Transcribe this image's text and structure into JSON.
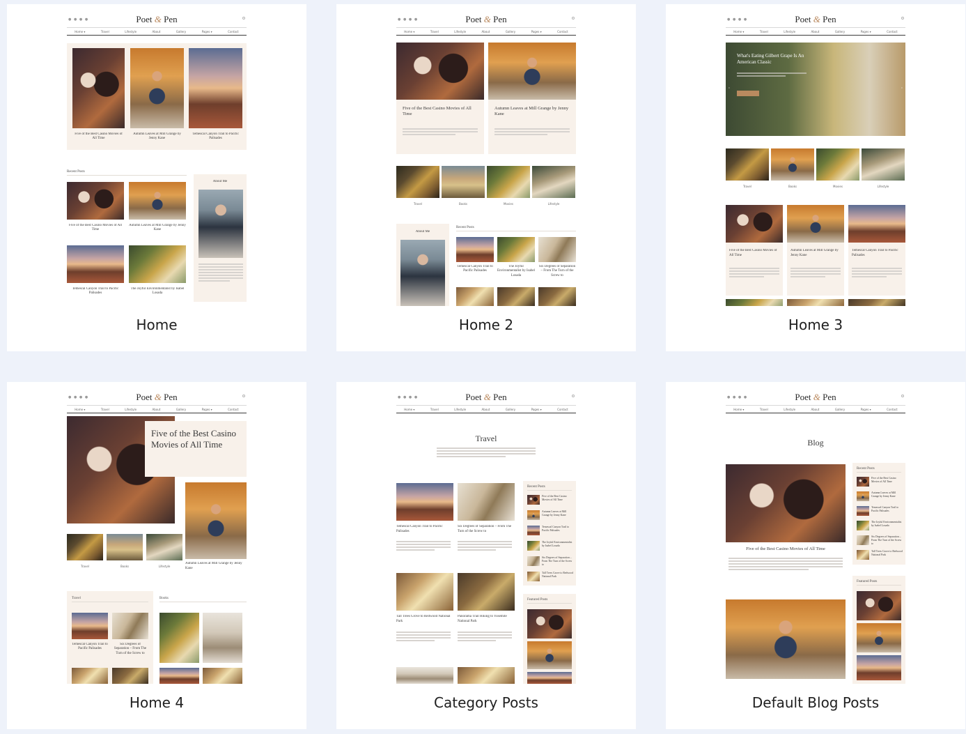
{
  "logo": {
    "left": "Poet",
    "amp": "&",
    "right": "Pen"
  },
  "nav_items": [
    "Home ▾",
    "Travel",
    "Lifestyle",
    "About",
    "Gallery",
    "Pages ▾",
    "Contact"
  ],
  "cards": [
    {
      "label": "Home"
    },
    {
      "label": "Home 2"
    },
    {
      "label": "Home 3"
    },
    {
      "label": "Home 4"
    },
    {
      "label": "Category Posts"
    },
    {
      "label": "Default Blog Posts"
    }
  ],
  "home": {
    "captions": [
      "Five of the Best Casino Movies of All Time",
      "Autumn Leaves at Mill Grange by Jenny Kane",
      "Temescal Canyon Trail to Pacific Palisades"
    ],
    "recent_posts": "Recent Posts",
    "about_me": "About Me",
    "grid_captions": [
      "Five of the Best Casino Movies of All Time",
      "Autumn Leaves at Mill Grange by Jenny Kane",
      "Temescal Canyon Trail to Pacific Palisades",
      "The Joyful Environmentalist by Isabel Losada"
    ]
  },
  "home2": {
    "posts": [
      "Five of the Best Casino Movies of All Time",
      "Autumn Leaves at Mill Grange by Jenny Kane"
    ],
    "categories": [
      "Travel",
      "Books",
      "Movies",
      "Lifestyle"
    ],
    "about_me": "About Me",
    "recent_posts": "Recent Posts",
    "recent_captions": [
      "Temescal Canyon Trail to Pacific Palisades",
      "The Joyful Environmentalist by Isabel Losada",
      "Six Degrees of Separation – From The Turn of the Screw to"
    ]
  },
  "home3": {
    "hero_title": "What's Eating Gilbert Grape Is An American Classic",
    "categories": [
      "Travel",
      "Books",
      "Movies",
      "Lifestyle"
    ],
    "posts": [
      "Five of the Best Casino Movies of All Time",
      "Autumn Leaves at Mill Grange by Jenny Kane",
      "Temescal Canyon Trail to Pacific Palisades"
    ]
  },
  "home4": {
    "hero_title": "Five of the Best Casino Movies of All Time",
    "categories": [
      "Travel",
      "Books",
      "Lifestyle"
    ],
    "side_caption": "Autumn Leaves at Mill Grange by Jenny Kane",
    "travel_label": "Travel",
    "books_label": "Books",
    "travel_captions": [
      "Temescal Canyon Trail to Pacific Palisades",
      "Six Degrees of Separation – From The Turn of the Screw to"
    ]
  },
  "category": {
    "title": "Travel",
    "posts": [
      "Temescal Canyon Trail to Pacific Palisades",
      "Six Degrees of Separation – From The Turn of the Screw to",
      "Tall Trees Grove to Redwood National Park",
      "Panorama Trail Hiking to Yosemite National Park"
    ],
    "recent_posts": "Recent Posts",
    "recent_items": [
      "Five of the Best Casino Movies of All Time",
      "Autumn Leaves at Mill Grange by Jenny Kane",
      "Temescal Canyon Trail to Pacific Palisades",
      "The Joyful Environmentalist by Isabel Losada",
      "Six Degrees of Separation – From The Turn of the Screw to",
      "Tall Trees Grove to Redwood National Park"
    ],
    "featured_posts": "Featured Posts"
  },
  "blog": {
    "title": "Blog",
    "post_title": "Five of the Best Casino Movies of All Time",
    "recent_posts": "Recent Posts",
    "recent_items": [
      "Five of the Best Casino Movies of All Time",
      "Autumn Leaves at Mill Grange by Jenny Kane",
      "Temescal Canyon Trail to Pacific Palisades",
      "The Joyful Environmentalist by Isabel Losada",
      "Six Degrees of Separation – From The Turn of the Screw to",
      "Tall Trees Grove to Redwood National Park"
    ],
    "featured_posts": "Featured Posts"
  }
}
